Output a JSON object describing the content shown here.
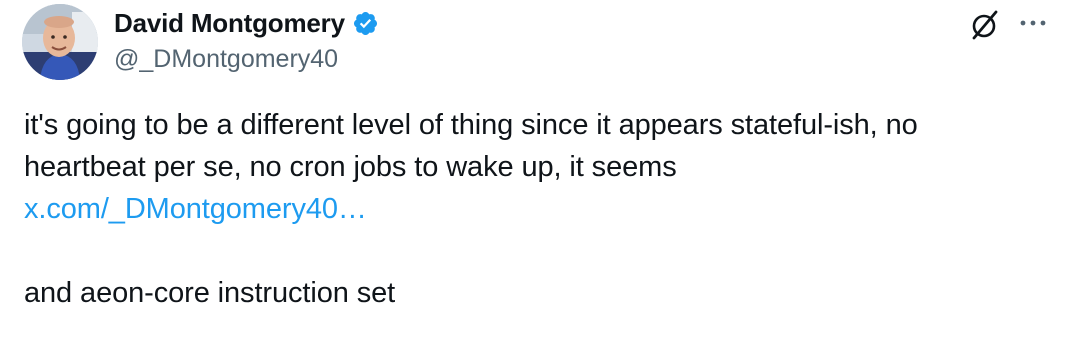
{
  "author": {
    "display_name": "David Montgomery",
    "handle": "@_DMontgomery40",
    "verified": true
  },
  "header_actions": {
    "grok_icon": "grok-slash-icon",
    "more_icon": "more-horizontal-icon"
  },
  "post": {
    "line1": "it's going to be a different level of thing since it appears stateful-ish, no",
    "line2": "heartbeat per se, no cron jobs to wake up, it seems",
    "link_text": "x.com/_DMontgomery40…",
    "line4": "and aeon-core instruction set"
  },
  "colors": {
    "link": "#1d9bf0",
    "verified_badge": "#1d9bf0",
    "text_primary": "#0f1419",
    "text_secondary": "#536471"
  }
}
